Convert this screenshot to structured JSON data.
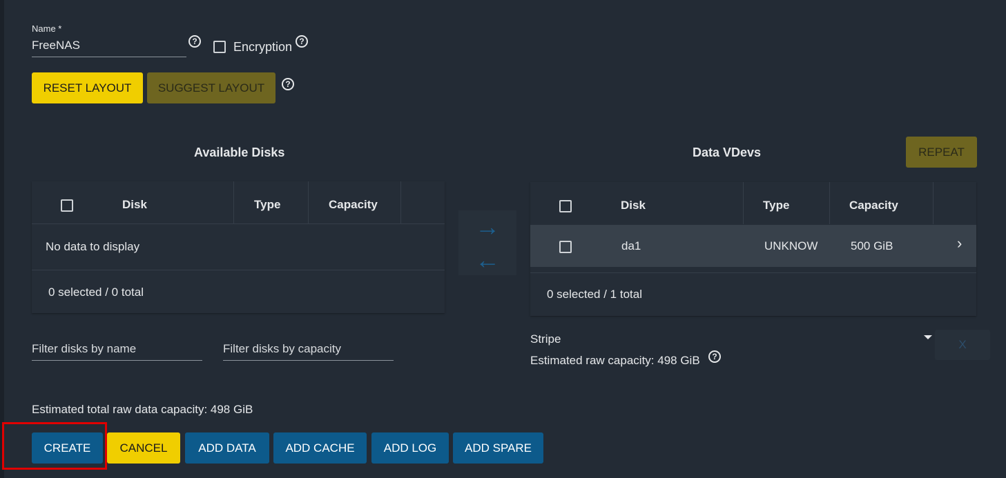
{
  "form": {
    "name_label": "Name *",
    "name_value": "FreeNAS",
    "encryption_label": "Encryption",
    "help_glyph": "?"
  },
  "layout_buttons": {
    "reset": "RESET LAYOUT",
    "suggest": "SUGGEST LAYOUT"
  },
  "available": {
    "title": "Available Disks",
    "columns": [
      "Disk",
      "Type",
      "Capacity"
    ],
    "empty_text": "No data to display",
    "footer": "0 selected / 0 total",
    "filter_name_placeholder": "Filter disks by name",
    "filter_capacity_placeholder": "Filter disks by capacity"
  },
  "vdevs": {
    "title": "Data VDevs",
    "repeat_label": "REPEAT",
    "columns": [
      "Disk",
      "Type",
      "Capacity"
    ],
    "rows": [
      {
        "disk": "da1",
        "type": "UNKNOW",
        "capacity": "500 GiB",
        "chevron": "›"
      }
    ],
    "footer": "0 selected / 1 total",
    "layout_value": "Stripe",
    "estimated": "Estimated raw capacity: 498 GiB",
    "remove_label": "X"
  },
  "transfer": {
    "right_arrow": "→",
    "left_arrow": "←"
  },
  "total_capacity": "Estimated total raw data capacity: 498 GiB",
  "actions": {
    "create": "CREATE",
    "cancel": "CANCEL",
    "add_data": "ADD DATA",
    "add_cache": "ADD CACHE",
    "add_log": "ADD LOG",
    "add_spare": "ADD SPARE"
  },
  "colors": {
    "background": "#232b35",
    "yellow": "#f0ce00",
    "olive": "#6e6520",
    "blue": "#0d5a8b",
    "highlight": "#e00000"
  }
}
